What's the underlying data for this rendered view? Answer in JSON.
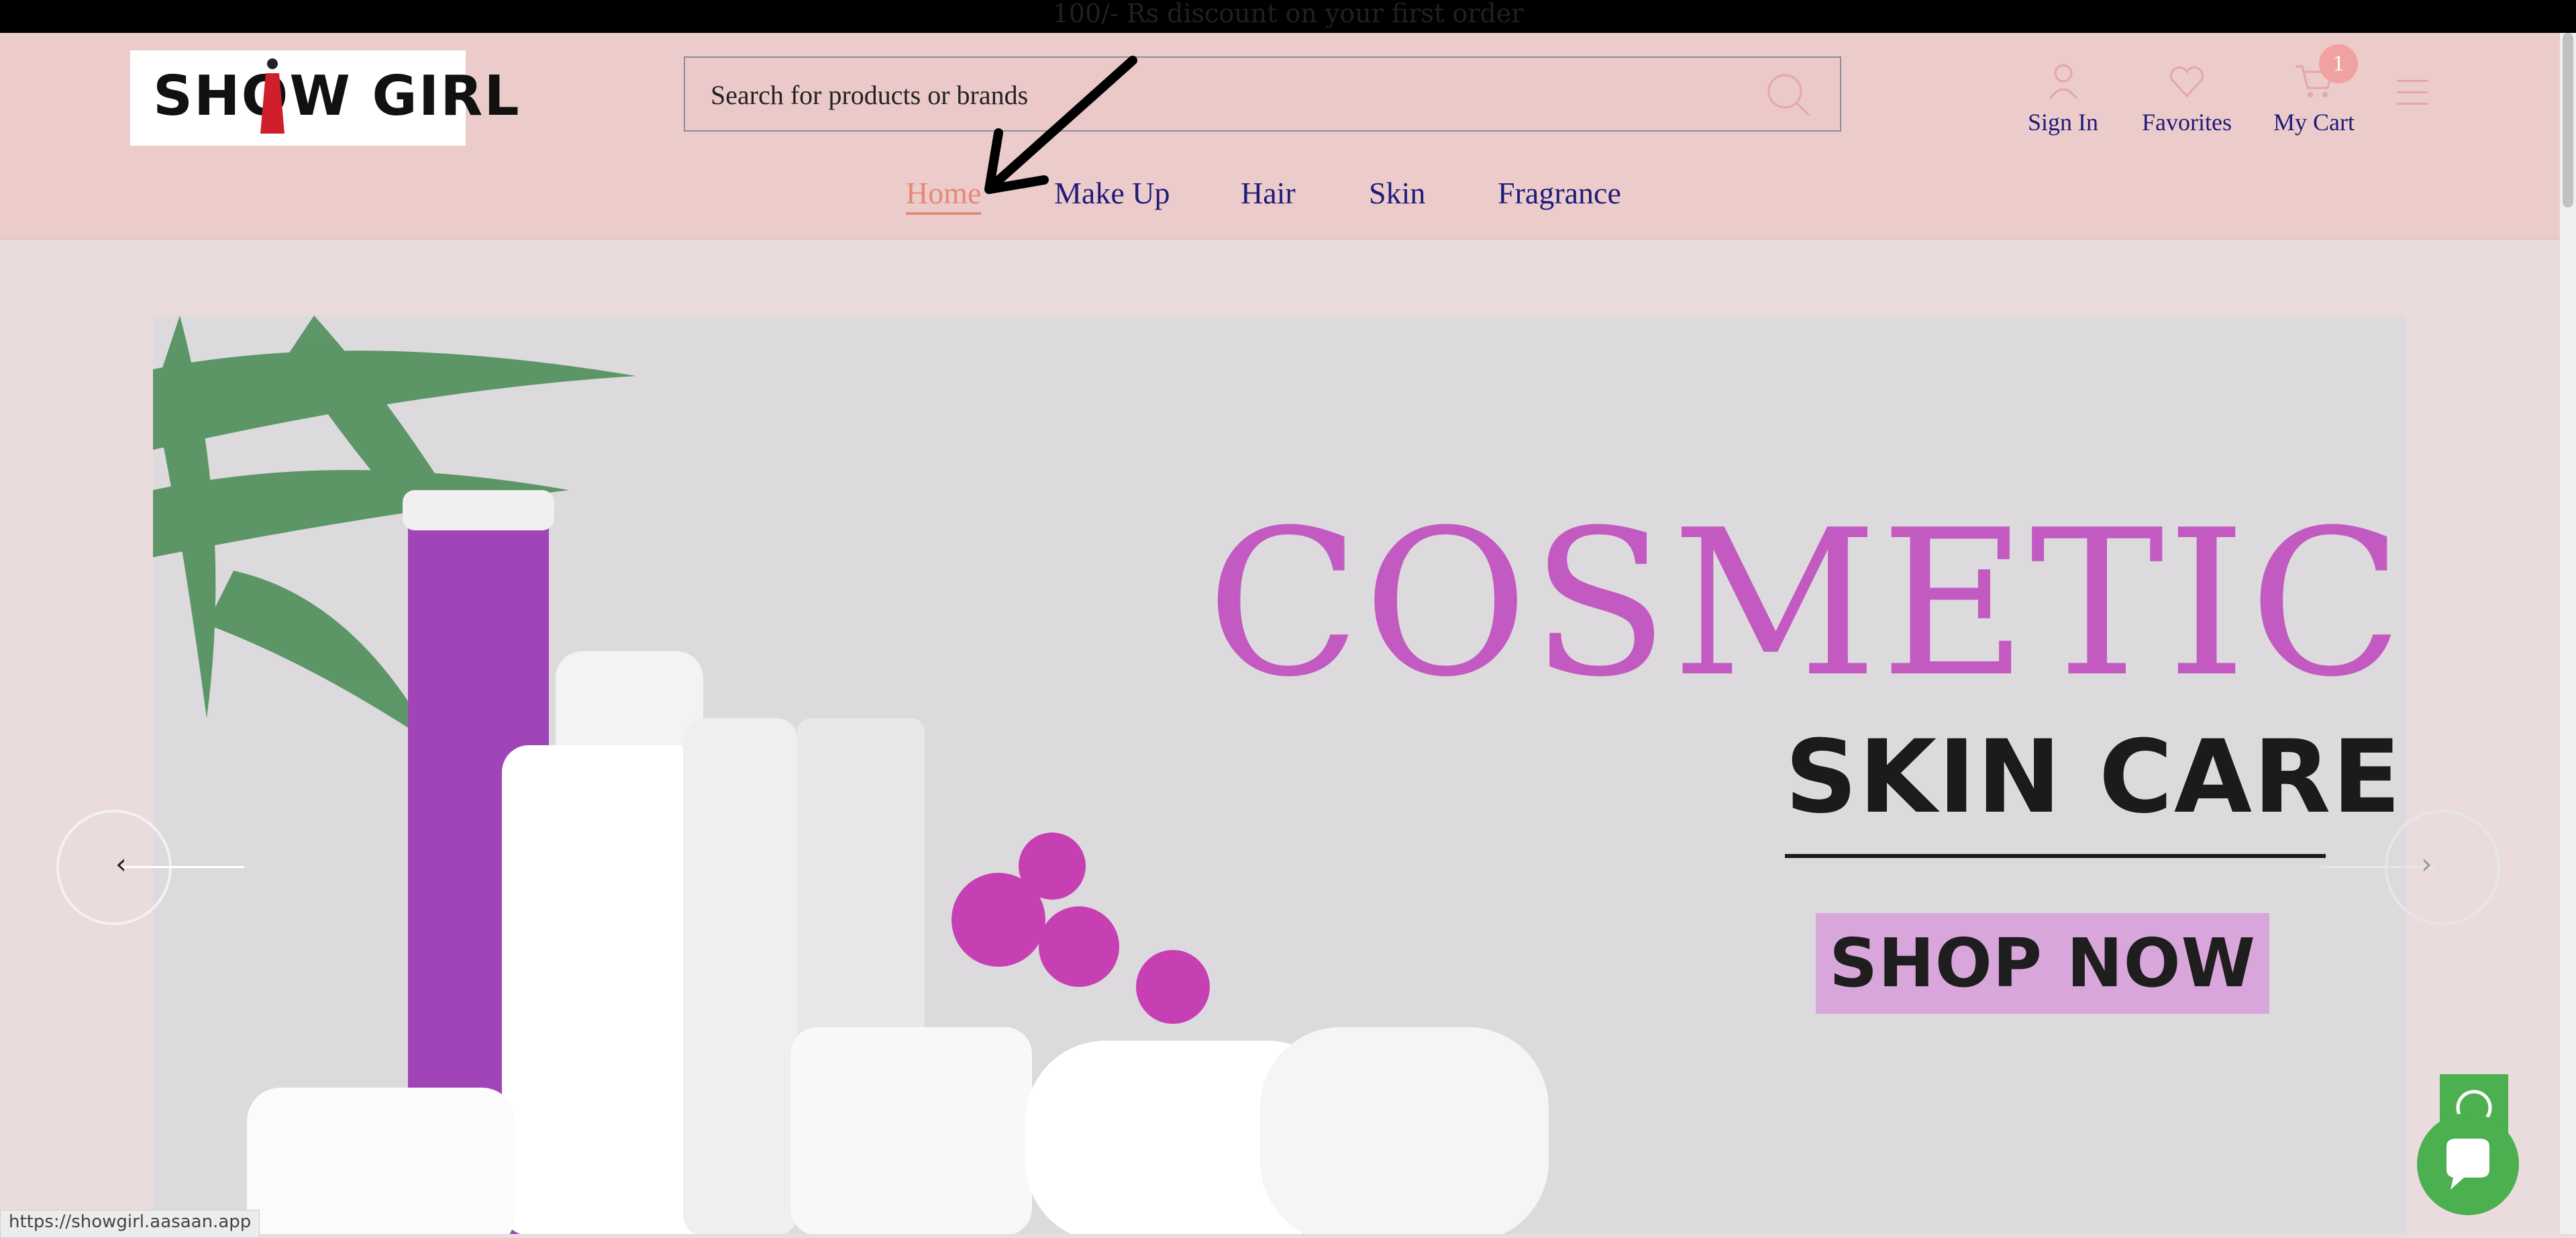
{
  "announcement": "100/- Rs discount on your first order",
  "logo": {
    "text": "SHOW GIRL"
  },
  "search": {
    "placeholder": "Search for products or brands"
  },
  "header_actions": {
    "sign_in": "Sign In",
    "favorites": "Favorites",
    "cart": "My Cart",
    "cart_count": "1"
  },
  "nav": {
    "items": [
      "Home",
      "Make Up",
      "Hair",
      "Skin",
      "Fragrance"
    ],
    "active": "Home"
  },
  "banner": {
    "headline": "COSMETIC",
    "subheadline": "SKIN CARE",
    "cta": "SHOP NOW"
  },
  "status_bar": {
    "url": "https://showgirl.aasaan.app"
  },
  "colors": {
    "header_bg": "#eccbcb",
    "nav_text": "#1f1b7a",
    "nav_active": "#e4897a",
    "headline": "#c25ac1",
    "cta_bg": "#d8a6db",
    "whatsapp": "#4caf50"
  },
  "icons": [
    "user-icon",
    "heart-icon",
    "cart-icon",
    "search-icon",
    "hamburger-menu-icon",
    "chevron-left-icon",
    "chevron-right-icon",
    "whatsapp-icon",
    "chat-icon"
  ]
}
